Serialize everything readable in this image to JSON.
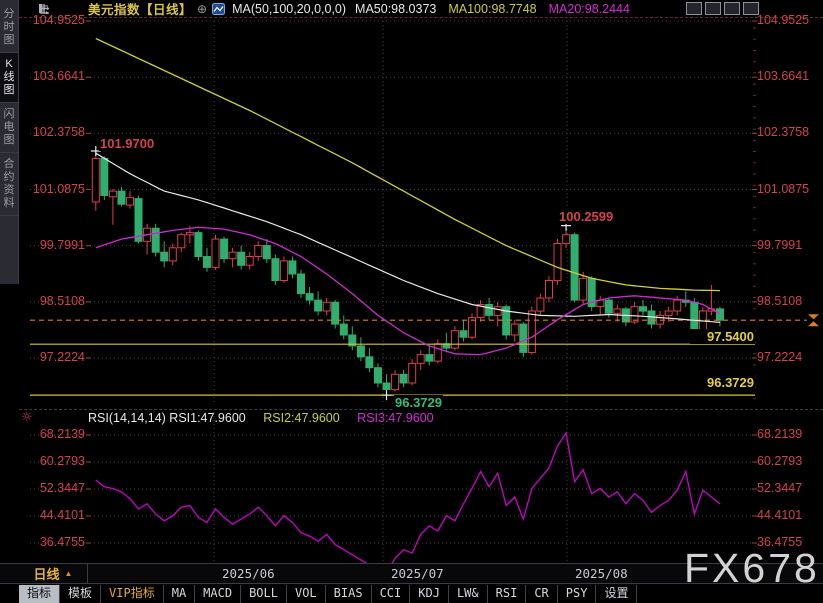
{
  "app": {
    "title": "美元指数【日线】",
    "add_symbol": "⊕",
    "watermark": "FX678"
  },
  "sidebar": {
    "items": [
      {
        "label": "分时图",
        "name": "sidebar-item-time-chart",
        "selected": false
      },
      {
        "label": "K线图",
        "name": "sidebar-item-kline-chart",
        "selected": true
      },
      {
        "label": "闪电图",
        "name": "sidebar-item-flash-chart",
        "selected": false
      },
      {
        "label": "合约资料",
        "name": "sidebar-item-contract-info",
        "selected": false
      }
    ]
  },
  "topbar": {
    "window_icons": [
      "crosshair-move-icon",
      "fit-vertical-axis-icon",
      "fit-horizontal-axis-icon",
      "shift-window-right-icon"
    ]
  },
  "palette": {
    "up": "#e13c4a",
    "down": "#2fae6e",
    "ma50": "#e8e8e8",
    "ma100": "#cdcd3a",
    "ma20": "#cf2bcf",
    "grid": "#4a4040",
    "tick": "#9c4040",
    "axis_text": "#d5414e",
    "level_line": "#d9c52e",
    "last_price_line": "#e07c20",
    "rsi_line": "#cc00cc",
    "annotation_red": "#d5414e",
    "annotation_green": "#2fbf7a",
    "annotation_yellow": "#e3cf3e"
  },
  "chart_data": [
    {
      "type": "candlestick",
      "title": "美元指数【日线】",
      "period": "日线",
      "ma_legend": {
        "formula": "MA(50,100,20,0,0,0)",
        "ma50": "MA50:98.0373",
        "ma100": "MA100:98.7748",
        "ma20": "MA20:98.2444"
      },
      "ylabels": [
        104.9525,
        103.6641,
        102.3758,
        101.0875,
        99.7991,
        98.5108,
        97.2224
      ],
      "xlabels": [
        "2025/06",
        "2025/07",
        "2025/08"
      ],
      "annotations": {
        "swing_high_1": "101.9700",
        "swing_high_2": "100.2599",
        "swing_low": "96.3729",
        "level_1": "97.5400",
        "level_2": "96.3729"
      },
      "level_lines": [
        97.54,
        96.3729
      ],
      "last_price_line": 98.09,
      "cross_markers": [
        {
          "i": 0,
          "p": 101.97
        },
        {
          "i": 55,
          "p": 100.2599
        },
        {
          "i": 34,
          "p": 96.3729
        }
      ],
      "candles_ohlc": [
        [
          100.8,
          101.97,
          100.6,
          101.8
        ],
        [
          101.8,
          101.85,
          100.85,
          100.95
        ],
        [
          100.92,
          101.1,
          100.28,
          101.05
        ],
        [
          101.05,
          101.15,
          100.7,
          100.75
        ],
        [
          100.73,
          101.05,
          100.65,
          100.9
        ],
        [
          100.88,
          100.95,
          99.85,
          99.9
        ],
        [
          99.9,
          100.3,
          99.6,
          100.2
        ],
        [
          100.2,
          100.3,
          99.55,
          99.65
        ],
        [
          99.65,
          99.9,
          99.3,
          99.45
        ],
        [
          99.45,
          99.85,
          99.35,
          99.75
        ],
        [
          99.75,
          100.1,
          99.65,
          100.05
        ],
        [
          100.05,
          100.25,
          99.85,
          100.1
        ],
        [
          100.1,
          100.15,
          99.45,
          99.55
        ],
        [
          99.55,
          99.75,
          99.2,
          99.3
        ],
        [
          99.3,
          100.05,
          99.25,
          99.95
        ],
        [
          99.95,
          100.0,
          99.4,
          99.5
        ],
        [
          99.5,
          99.75,
          99.3,
          99.65
        ],
        [
          99.65,
          99.8,
          99.25,
          99.35
        ],
        [
          99.35,
          99.65,
          99.25,
          99.55
        ],
        [
          99.55,
          99.9,
          99.45,
          99.8
        ],
        [
          99.8,
          99.95,
          99.4,
          99.5
        ],
        [
          99.5,
          99.6,
          98.9,
          99.0
        ],
        [
          99.0,
          99.55,
          98.95,
          99.45
        ],
        [
          99.45,
          99.55,
          99.05,
          99.15
        ],
        [
          99.15,
          99.25,
          98.6,
          98.7
        ],
        [
          98.7,
          98.85,
          98.45,
          98.55
        ],
        [
          98.55,
          98.75,
          98.2,
          98.3
        ],
        [
          98.3,
          98.6,
          98.2,
          98.5
        ],
        [
          98.5,
          98.55,
          97.9,
          98.0
        ],
        [
          98.0,
          98.2,
          97.65,
          97.75
        ],
        [
          97.75,
          97.95,
          97.4,
          97.5
        ],
        [
          97.5,
          97.7,
          97.15,
          97.25
        ],
        [
          97.25,
          97.45,
          96.9,
          97.0
        ],
        [
          97.0,
          97.1,
          96.55,
          96.65
        ],
        [
          96.65,
          96.85,
          96.3729,
          96.5
        ],
        [
          96.5,
          96.95,
          96.45,
          96.85
        ],
        [
          96.85,
          96.95,
          96.55,
          96.65
        ],
        [
          96.65,
          97.2,
          96.6,
          97.1
        ],
        [
          97.1,
          97.4,
          96.95,
          97.3
        ],
        [
          97.3,
          97.5,
          97.05,
          97.15
        ],
        [
          97.15,
          97.65,
          97.1,
          97.55
        ],
        [
          97.55,
          97.8,
          97.35,
          97.45
        ],
        [
          97.45,
          97.95,
          97.4,
          97.85
        ],
        [
          97.85,
          98.1,
          97.6,
          97.7
        ],
        [
          97.7,
          98.25,
          97.65,
          98.15
        ],
        [
          98.15,
          98.55,
          98.05,
          98.45
        ],
        [
          98.45,
          98.6,
          98.1,
          98.2
        ],
        [
          98.2,
          98.5,
          97.95,
          98.4
        ],
        [
          98.4,
          98.45,
          97.65,
          97.75
        ],
        [
          97.75,
          98.1,
          97.6,
          98.0
        ],
        [
          98.0,
          98.05,
          97.25,
          97.35
        ],
        [
          97.35,
          98.4,
          97.3,
          98.3
        ],
        [
          98.3,
          98.7,
          98.2,
          98.6
        ],
        [
          98.6,
          99.1,
          98.5,
          99.0
        ],
        [
          99.0,
          99.95,
          98.9,
          99.85
        ],
        [
          99.85,
          100.2599,
          99.75,
          100.05
        ],
        [
          100.05,
          100.1,
          98.5,
          98.55
        ],
        [
          98.55,
          99.2,
          98.45,
          99.05
        ],
        [
          99.05,
          99.1,
          98.3,
          98.4
        ],
        [
          98.4,
          98.65,
          98.2,
          98.55
        ],
        [
          98.55,
          98.6,
          98.15,
          98.25
        ],
        [
          98.25,
          98.45,
          98.05,
          98.35
        ],
        [
          98.35,
          98.4,
          97.95,
          98.05
        ],
        [
          98.05,
          98.5,
          98.0,
          98.4
        ],
        [
          98.4,
          98.55,
          98.2,
          98.3
        ],
        [
          98.3,
          98.45,
          97.9,
          98.0
        ],
        [
          98.0,
          98.3,
          97.9,
          98.2
        ],
        [
          98.2,
          98.4,
          98.05,
          98.3
        ],
        [
          98.3,
          98.65,
          98.2,
          98.55
        ],
        [
          98.55,
          98.75,
          98.4,
          98.5
        ],
        [
          98.5,
          98.6,
          97.6,
          97.7
        ],
        [
          97.7,
          98.4,
          97.65,
          98.3
        ],
        [
          98.3,
          98.9,
          98.2,
          98.35
        ],
        [
          98.35,
          98.4,
          97.95,
          98.09
        ]
      ],
      "ma100_anchors": [
        [
          0,
          104.55
        ],
        [
          6,
          104.0
        ],
        [
          12,
          103.45
        ],
        [
          18,
          102.9
        ],
        [
          24,
          102.3
        ],
        [
          30,
          101.7
        ],
        [
          36,
          101.05
        ],
        [
          42,
          100.4
        ],
        [
          48,
          99.8
        ],
        [
          54,
          99.3
        ],
        [
          58,
          99.05
        ],
        [
          62,
          98.9
        ],
        [
          66,
          98.82
        ],
        [
          70,
          98.78
        ],
        [
          73,
          98.77
        ]
      ],
      "ma50_anchors": [
        [
          0,
          101.92
        ],
        [
          4,
          101.45
        ],
        [
          8,
          101.05
        ],
        [
          12,
          100.85
        ],
        [
          16,
          100.6
        ],
        [
          20,
          100.35
        ],
        [
          24,
          100.05
        ],
        [
          28,
          99.7
        ],
        [
          32,
          99.35
        ],
        [
          36,
          99.0
        ],
        [
          40,
          98.7
        ],
        [
          44,
          98.45
        ],
        [
          48,
          98.3
        ],
        [
          52,
          98.2
        ],
        [
          56,
          98.18
        ],
        [
          60,
          98.22
        ],
        [
          64,
          98.18
        ],
        [
          68,
          98.12
        ],
        [
          73,
          98.04
        ]
      ],
      "ma20_anchors": [
        [
          0,
          99.75
        ],
        [
          3,
          99.95
        ],
        [
          6,
          100.05
        ],
        [
          9,
          100.15
        ],
        [
          12,
          100.22
        ],
        [
          15,
          100.18
        ],
        [
          18,
          100.05
        ],
        [
          21,
          99.85
        ],
        [
          24,
          99.55
        ],
        [
          27,
          99.15
        ],
        [
          30,
          98.7
        ],
        [
          33,
          98.2
        ],
        [
          36,
          97.8
        ],
        [
          39,
          97.5
        ],
        [
          42,
          97.32
        ],
        [
          45,
          97.3
        ],
        [
          48,
          97.45
        ],
        [
          51,
          97.7
        ],
        [
          54,
          98.1
        ],
        [
          57,
          98.45
        ],
        [
          60,
          98.6
        ],
        [
          63,
          98.65
        ],
        [
          66,
          98.6
        ],
        [
          69,
          98.55
        ],
        [
          71,
          98.45
        ],
        [
          73,
          98.24
        ]
      ]
    },
    {
      "type": "line",
      "title": "RSI(14,14,14)",
      "legend": {
        "white": "RSI(14,14,14) RSI1:47.9600",
        "yellow": "RSI2:47.9600",
        "magenta": "RSI3:47.9600"
      },
      "ylabels": [
        68.2139,
        60.2793,
        52.3447,
        44.4101,
        36.4755
      ],
      "values": [
        55.0,
        53.0,
        52.5,
        51.5,
        49.5,
        46.5,
        48.0,
        45.0,
        43.0,
        44.5,
        47.0,
        47.5,
        44.0,
        42.5,
        46.5,
        44.0,
        42.0,
        43.5,
        45.0,
        47.0,
        44.5,
        41.5,
        44.5,
        42.5,
        39.5,
        38.5,
        37.0,
        39.0,
        36.0,
        34.5,
        33.0,
        31.5,
        30.0,
        28.5,
        27.5,
        32.0,
        34.5,
        33.5,
        39.0,
        41.5,
        40.0,
        44.5,
        43.0,
        48.0,
        52.5,
        57.5,
        53.0,
        57.0,
        47.5,
        50.0,
        43.5,
        52.5,
        55.5,
        58.5,
        65.0,
        68.8,
        54.5,
        58.0,
        51.0,
        52.5,
        50.0,
        51.5,
        48.0,
        51.0,
        49.0,
        45.5,
        47.5,
        49.0,
        52.0,
        57.5,
        45.0,
        52.0,
        50.0,
        47.96
      ]
    }
  ],
  "xaxis": {
    "period": "日线",
    "period_arrow": "▲",
    "dates": [
      "2025/06",
      "2025/07",
      "2025/08"
    ]
  },
  "tabbar": {
    "items": [
      {
        "label": "指标",
        "selected": true
      },
      {
        "label": "模板"
      },
      {
        "label": "VIP指标",
        "accent": true
      },
      {
        "label": "MA"
      },
      {
        "label": "MACD"
      },
      {
        "label": "BOLL"
      },
      {
        "label": "VOL"
      },
      {
        "label": "BIAS"
      },
      {
        "label": "CCI"
      },
      {
        "label": "KDJ"
      },
      {
        "label": "LW&"
      },
      {
        "label": "RSI"
      },
      {
        "label": "CR"
      },
      {
        "label": "PSY"
      },
      {
        "label": "设置"
      }
    ]
  }
}
